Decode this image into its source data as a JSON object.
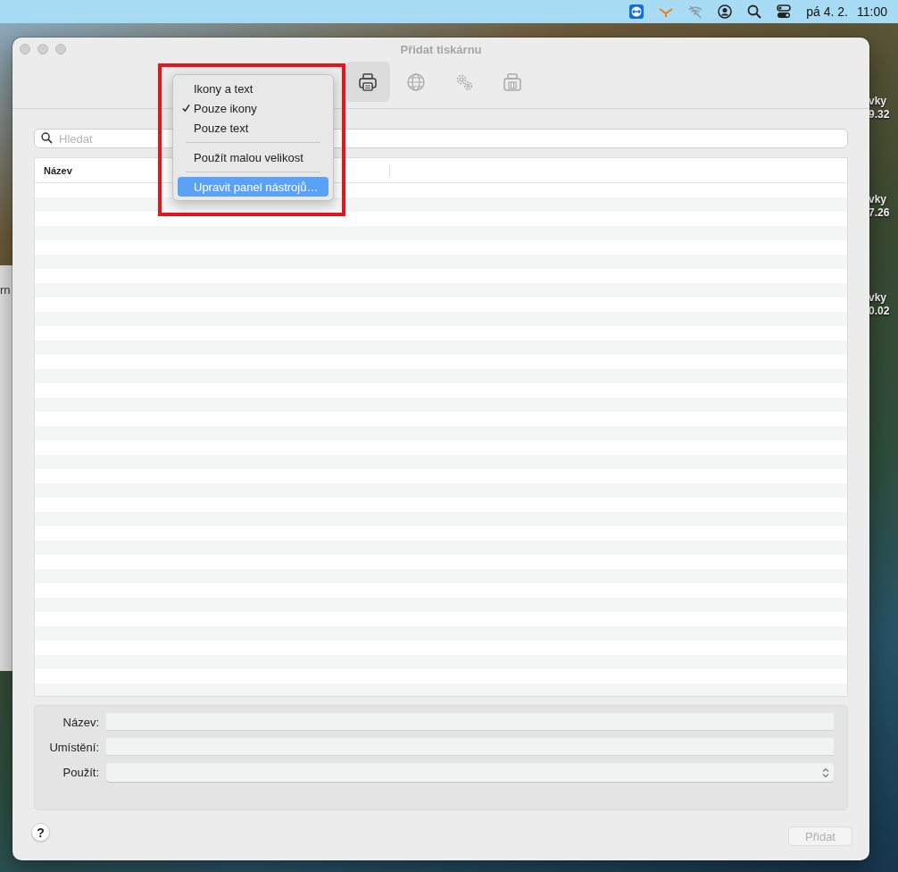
{
  "menu_bar": {
    "icons": [
      {
        "kind": "remote"
      },
      {
        "kind": "chevron"
      },
      {
        "kind": "wifi_off"
      },
      {
        "kind": "user"
      },
      {
        "kind": "search"
      },
      {
        "kind": "toggles"
      }
    ],
    "date": "pá 4. 2.",
    "time": "11:00"
  },
  "desktop_labels": [
    {
      "line_1": "vky",
      "line_2": "9.32"
    },
    {
      "line_1": "vky",
      "line_2": "7.26"
    },
    {
      "line_1": "vky",
      "line_2": "0.02"
    }
  ],
  "background_window": {
    "title_fragment": "rn"
  },
  "window": {
    "title": "Přidat tiskárnu",
    "toolbar": [
      {
        "kind": "printer",
        "selected": true
      },
      {
        "kind": "globe",
        "selected": false
      },
      {
        "kind": "gears",
        "selected": false
      },
      {
        "kind": "fax",
        "selected": false
      }
    ],
    "search": {
      "placeholder": "Hledat"
    },
    "table": {
      "columns": [
        "Název"
      ]
    },
    "form": [
      {
        "label": "Název:",
        "kind": "text"
      },
      {
        "label": "Umístění:",
        "kind": "text"
      },
      {
        "label": "Použít:",
        "kind": "popup"
      }
    ],
    "help_button": "?",
    "add_button": {
      "label": "Přidat",
      "disabled": true
    }
  },
  "context_menu": {
    "items": [
      {
        "kind": "item",
        "label": "Ikony a text",
        "checked": false,
        "selected": false
      },
      {
        "kind": "item",
        "label": "Pouze ikony",
        "checked": true,
        "selected": false
      },
      {
        "kind": "item",
        "label": "Pouze text",
        "checked": false,
        "selected": false
      },
      {
        "kind": "separator"
      },
      {
        "kind": "item",
        "label": "Použít malou velikost",
        "checked": false,
        "selected": false
      },
      {
        "kind": "separator"
      },
      {
        "kind": "item",
        "label": "Upravit panel nástrojů…",
        "checked": false,
        "selected": true
      }
    ]
  }
}
